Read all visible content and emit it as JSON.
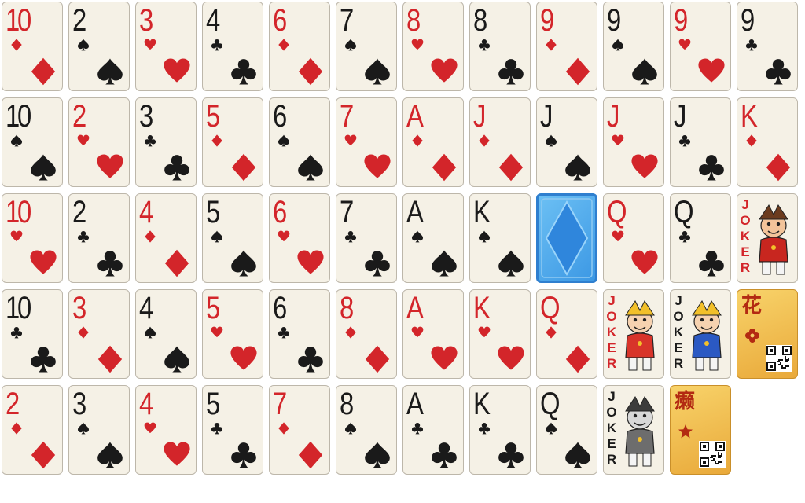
{
  "colors": {
    "red": "#d3252a",
    "black": "#1a1a1a",
    "card_face": "#f5f1e6",
    "card_back": "#3c98e4",
    "special_gold": "#f0be50"
  },
  "rows": [
    [
      {
        "type": "number",
        "rank": "10",
        "suit": "diamond"
      },
      {
        "type": "number",
        "rank": "2",
        "suit": "spade"
      },
      {
        "type": "number",
        "rank": "3",
        "suit": "heart"
      },
      {
        "type": "number",
        "rank": "4",
        "suit": "club"
      },
      {
        "type": "number",
        "rank": "6",
        "suit": "diamond"
      },
      {
        "type": "number",
        "rank": "7",
        "suit": "spade"
      },
      {
        "type": "number",
        "rank": "8",
        "suit": "heart"
      },
      {
        "type": "number",
        "rank": "8",
        "suit": "club"
      },
      {
        "type": "number",
        "rank": "9",
        "suit": "diamond"
      },
      {
        "type": "number",
        "rank": "9",
        "suit": "spade"
      },
      {
        "type": "number",
        "rank": "9",
        "suit": "heart"
      },
      {
        "type": "number",
        "rank": "9",
        "suit": "club"
      }
    ],
    [
      {
        "type": "number",
        "rank": "10",
        "suit": "spade"
      },
      {
        "type": "number",
        "rank": "2",
        "suit": "heart"
      },
      {
        "type": "number",
        "rank": "3",
        "suit": "club"
      },
      {
        "type": "number",
        "rank": "5",
        "suit": "diamond"
      },
      {
        "type": "number",
        "rank": "6",
        "suit": "spade"
      },
      {
        "type": "number",
        "rank": "7",
        "suit": "heart"
      },
      {
        "type": "number",
        "rank": "A",
        "suit": "diamond"
      },
      {
        "type": "number",
        "rank": "J",
        "suit": "diamond"
      },
      {
        "type": "number",
        "rank": "J",
        "suit": "spade"
      },
      {
        "type": "number",
        "rank": "J",
        "suit": "heart"
      },
      {
        "type": "number",
        "rank": "J",
        "suit": "club"
      },
      {
        "type": "number",
        "rank": "K",
        "suit": "diamond"
      }
    ],
    [
      {
        "type": "number",
        "rank": "10",
        "suit": "heart"
      },
      {
        "type": "number",
        "rank": "2",
        "suit": "club"
      },
      {
        "type": "number",
        "rank": "4",
        "suit": "diamond"
      },
      {
        "type": "number",
        "rank": "5",
        "suit": "spade"
      },
      {
        "type": "number",
        "rank": "6",
        "suit": "heart"
      },
      {
        "type": "number",
        "rank": "7",
        "suit": "club"
      },
      {
        "type": "number",
        "rank": "A",
        "suit": "spade"
      },
      {
        "type": "number",
        "rank": "K",
        "suit": "spade"
      },
      {
        "type": "back"
      },
      {
        "type": "number",
        "rank": "Q",
        "suit": "heart"
      },
      {
        "type": "number",
        "rank": "Q",
        "suit": "club"
      },
      {
        "type": "joker",
        "label": "JOKER",
        "color": "red",
        "figure": "red-joker"
      }
    ],
    [
      {
        "type": "number",
        "rank": "10",
        "suit": "club"
      },
      {
        "type": "number",
        "rank": "3",
        "suit": "diamond"
      },
      {
        "type": "number",
        "rank": "4",
        "suit": "spade"
      },
      {
        "type": "number",
        "rank": "5",
        "suit": "heart"
      },
      {
        "type": "number",
        "rank": "6",
        "suit": "club"
      },
      {
        "type": "number",
        "rank": "8",
        "suit": "diamond"
      },
      {
        "type": "number",
        "rank": "A",
        "suit": "heart"
      },
      {
        "type": "number",
        "rank": "K",
        "suit": "heart"
      },
      {
        "type": "number",
        "rank": "Q",
        "suit": "diamond"
      },
      {
        "type": "joker",
        "label": "JOKER",
        "color": "red",
        "figure": "jester-red"
      },
      {
        "type": "joker",
        "label": "JOKER",
        "color": "black",
        "figure": "jester-blue"
      },
      {
        "type": "special",
        "char": "花",
        "mark": "flower-icon",
        "qr": "qr-code-icon"
      }
    ],
    [
      {
        "type": "number",
        "rank": "2",
        "suit": "diamond"
      },
      {
        "type": "number",
        "rank": "3",
        "suit": "spade"
      },
      {
        "type": "number",
        "rank": "4",
        "suit": "heart"
      },
      {
        "type": "number",
        "rank": "5",
        "suit": "club"
      },
      {
        "type": "number",
        "rank": "7",
        "suit": "diamond"
      },
      {
        "type": "number",
        "rank": "8",
        "suit": "spade"
      },
      {
        "type": "number",
        "rank": "A",
        "suit": "club"
      },
      {
        "type": "number",
        "rank": "K",
        "suit": "club"
      },
      {
        "type": "number",
        "rank": "Q",
        "suit": "spade"
      },
      {
        "type": "joker",
        "label": "JOKER",
        "color": "black",
        "figure": "grey-joker"
      },
      {
        "type": "special",
        "char": "癞",
        "mark": "star-icon",
        "qr": "qr-code-icon"
      }
    ]
  ]
}
